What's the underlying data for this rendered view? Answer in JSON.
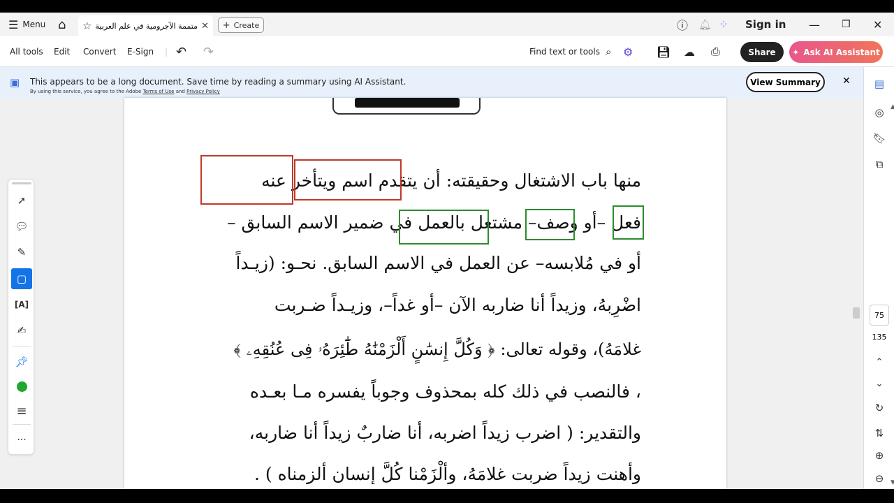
{
  "titlebar": {
    "menu_label": "Menu",
    "tab_title": "متممة الآجرومية في علم العربية",
    "create_label": "Create",
    "sign_in": "Sign in"
  },
  "toolbar": {
    "all_tools": "All tools",
    "edit": "Edit",
    "convert": "Convert",
    "esign": "E-Sign",
    "find": "Find text or tools",
    "share": "Share",
    "ai_assistant": "Ask AI Assistant"
  },
  "banner": {
    "message": "This appears to be a long document. Save time by reading a summary using AI Assistant.",
    "fine_print_prefix": "By using this service, you agree to the Adobe",
    "terms": "Terms of Use",
    "and": "and",
    "privacy": "Privacy Policy",
    "view_summary": "View Summary"
  },
  "document": {
    "lines": [
      "منها باب الاشتغال وحقيقته: أن يتقدم اسم ويتأخر عنه",
      "فعل –أو وصف– مشتغل بالعمل في ضمير الاسم السابق –",
      "أو في مُلابسه– عن العمل في الاسم السابق. نحـو: (زيـداً",
      "اضْرِبهُ، وزيداً أنا ضاربه الآن –أو غداً–، وزيـداً ضـربت",
      "غلامَهُ)، وقوله تعالى: ﴿ وَكُلَّ إِنسَٰنٍ أَلْزَمْنَٰهُ طَٰٓئِرَهُۥ فِى عُنُقِهِۦ ﴾",
      "، فالنصب في ذلك كله بمحذوف وجوباً يفسره مـا بعـده",
      "والتقدير: ( اضرب زيداً اضربه، أنا ضاربٌ زيداً أنا ضاربه،",
      "وأهنت زيداً ضربت غلامَهُ، وألْزَمْنا كُلَّ إنسان ألزمناه ) ."
    ]
  },
  "rail": {
    "page_current": "75",
    "page_total": "135"
  }
}
